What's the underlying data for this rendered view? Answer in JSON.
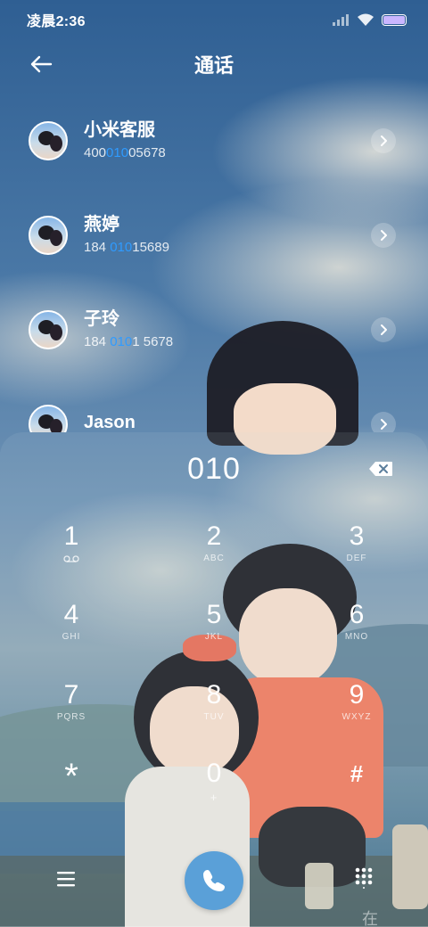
{
  "status_bar": {
    "time": "凌晨2:36",
    "icons": [
      "signal-icon",
      "wifi-icon",
      "battery-icon"
    ]
  },
  "header": {
    "back_icon": "arrow-left-icon",
    "title": "通话"
  },
  "contacts": [
    {
      "name": "小米客服",
      "number_pre": "400",
      "number_match": "010",
      "number_post": "05678"
    },
    {
      "name": "燕婷",
      "number_pre": "184 ",
      "number_match": "010",
      "number_post": "15689"
    },
    {
      "name": "子玲",
      "number_pre": "184 ",
      "number_match": "010",
      "number_post": "1 5678"
    },
    {
      "name": "Jason",
      "number_pre": "",
      "number_match": "",
      "number_post": ""
    }
  ],
  "dialer": {
    "input": "010",
    "keys": [
      {
        "digit": "1",
        "letters": ""
      },
      {
        "digit": "2",
        "letters": "ABC"
      },
      {
        "digit": "3",
        "letters": "DEF"
      },
      {
        "digit": "4",
        "letters": "GHI"
      },
      {
        "digit": "5",
        "letters": "JKL"
      },
      {
        "digit": "6",
        "letters": "MNO"
      },
      {
        "digit": "7",
        "letters": "PQRS"
      },
      {
        "digit": "8",
        "letters": "TUV"
      },
      {
        "digit": "9",
        "letters": "WXYZ"
      },
      {
        "digit": "*",
        "letters": ""
      },
      {
        "digit": "0",
        "letters": "+"
      },
      {
        "digit": "#",
        "letters": ""
      }
    ],
    "watermark": "在"
  },
  "colors": {
    "match_highlight": "#2f9bff",
    "call_button": "#5aa0d8",
    "battery_fill": "#c9b6ff"
  }
}
